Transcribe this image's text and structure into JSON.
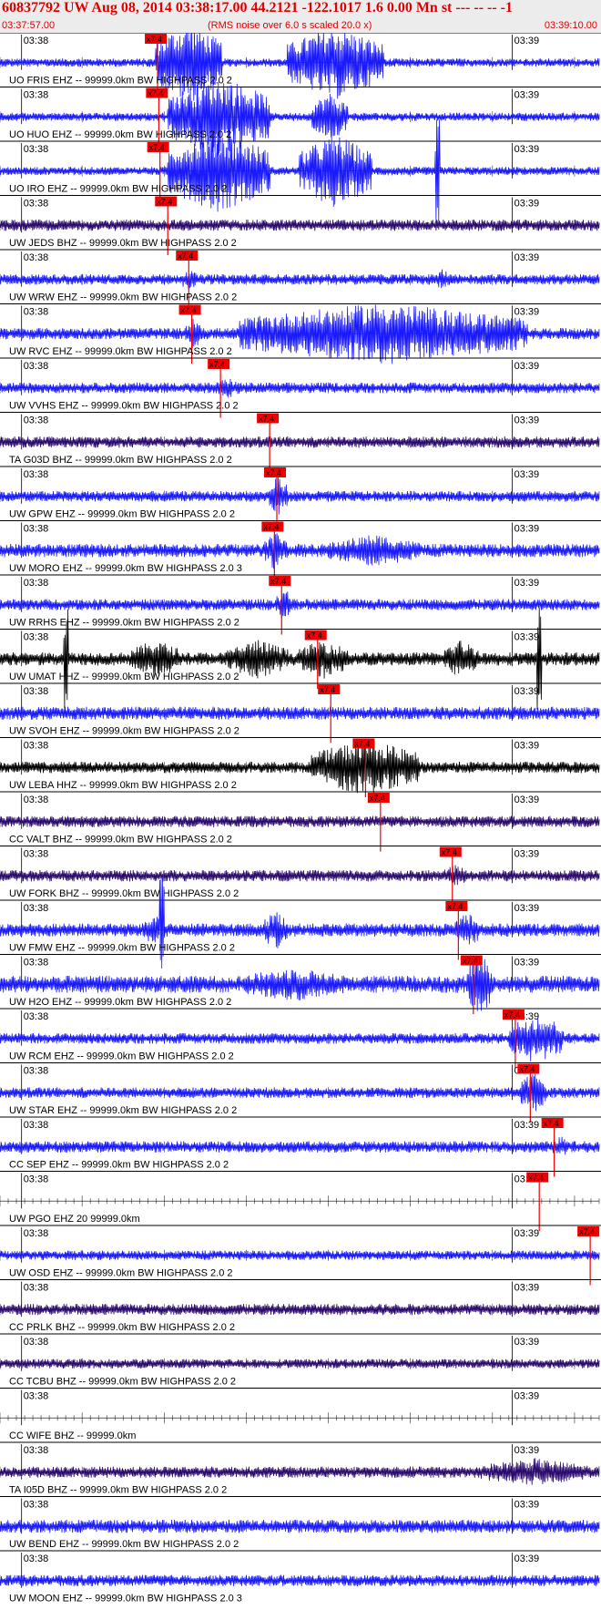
{
  "header": {
    "title": "60837792 UW Aug 08, 2014 03:38:17.00   44.2121 -122.1017  1.6 0.00 Mn st --- -- --  -1",
    "start_time": "03:37:57.00",
    "rms_note": "(RMS noise over 6.0 s scaled 20.0 x)",
    "end_time": "03:39:10.00"
  },
  "colors": {
    "blue": "#1a1aff",
    "black": "#000000",
    "navy": "#2a0a6e",
    "pick": "#ee0000",
    "header_bg": "#ececec"
  },
  "chart_data": {
    "type": "seismogram",
    "time_range": [
      "03:37:57.00",
      "03:39:10.00"
    ],
    "minute_labels": [
      "03:38",
      "03:39"
    ],
    "pick_label": "x7.4",
    "traces": [
      {
        "label": "UO FRIS EHZ -- 99999.0km BW  HIGHPASS  2.0  2",
        "color": "blue",
        "amp": 0.22,
        "pick_frac": 0.263,
        "bursts": [
          [
            0.26,
            0.37,
            10
          ],
          [
            0.48,
            0.64,
            9
          ]
        ],
        "spikes": []
      },
      {
        "label": "UO HUO EHZ -- 99999.0km BW  HIGHPASS  2.0  2",
        "color": "blue",
        "amp": 0.22,
        "pick_frac": 0.265,
        "bursts": [
          [
            0.28,
            0.45,
            10
          ],
          [
            0.52,
            0.58,
            6
          ]
        ],
        "spikes": []
      },
      {
        "label": "UO IRO EHZ -- 99999.0km BW  HIGHPASS  2.0  2",
        "color": "blue",
        "amp": 0.22,
        "pick_frac": 0.267,
        "bursts": [
          [
            0.28,
            0.45,
            10
          ],
          [
            0.5,
            0.62,
            9
          ]
        ],
        "spikes": [
          [
            0.73,
            5
          ]
        ]
      },
      {
        "label": "UW JEDS BHZ -- 99999.0km BW  HIGHPASS  2.0  2",
        "color": "navy",
        "amp": 0.3,
        "pick_frac": 0.28,
        "bursts": [],
        "spikes": []
      },
      {
        "label": "UW WRW EHZ -- 99999.0km BW  HIGHPASS  2.0  2",
        "color": "blue",
        "amp": 0.28,
        "pick_frac": 0.315,
        "bursts": [
          [
            0.3,
            0.33,
            2
          ],
          [
            0.72,
            0.76,
            2
          ]
        ],
        "spikes": []
      },
      {
        "label": "UW RVC EHZ -- 99999.0km BW  HIGHPASS  2.0  2",
        "color": "blue",
        "amp": 0.3,
        "pick_frac": 0.32,
        "bursts": [
          [
            0.31,
            0.34,
            3
          ],
          [
            0.4,
            0.88,
            5.5
          ]
        ],
        "spikes": []
      },
      {
        "label": "UW VVHS EHZ -- 99999.0km BW  HIGHPASS  2.0  2",
        "color": "blue",
        "amp": 0.28,
        "pick_frac": 0.368,
        "bursts": [
          [
            0.36,
            0.4,
            2
          ]
        ],
        "spikes": []
      },
      {
        "label": "TA G03D BHZ -- 99999.0km BW  HIGHPASS  2.0  2",
        "color": "navy",
        "amp": 0.3,
        "pick_frac": 0.45,
        "bursts": [],
        "spikes": []
      },
      {
        "label": "UW GPW EHZ -- 99999.0km BW  HIGHPASS  2.0  2",
        "color": "blue",
        "amp": 0.28,
        "pick_frac": 0.462,
        "bursts": [
          [
            0.45,
            0.48,
            4
          ]
        ],
        "spikes": []
      },
      {
        "label": "UW MORO EHZ -- 99999.0km BW  HIGHPASS  2.0  3",
        "color": "blue",
        "amp": 0.35,
        "pick_frac": 0.458,
        "bursts": [
          [
            0.44,
            0.48,
            3
          ],
          [
            0.55,
            0.7,
            2.5
          ]
        ],
        "spikes": []
      },
      {
        "label": "UW RRHS EHZ -- 99999.0km BW  HIGHPASS  2.0  2",
        "color": "blue",
        "amp": 0.3,
        "pick_frac": 0.47,
        "bursts": [
          [
            0.46,
            0.49,
            3
          ]
        ],
        "spikes": []
      },
      {
        "label": "UW UMAT HHZ -- 99999.0km BW  HIGHPASS  2.0  2",
        "color": "black",
        "amp": 0.35,
        "pick_frac": 0.53,
        "bursts": [
          [
            0.22,
            0.3,
            3
          ],
          [
            0.38,
            0.48,
            3
          ],
          [
            0.5,
            0.58,
            3
          ],
          [
            0.74,
            0.8,
            3
          ]
        ],
        "spikes": [
          [
            0.11,
            3
          ],
          [
            0.9,
            3
          ]
        ]
      },
      {
        "label": "UW SVOH EHZ -- 99999.0km BW  HIGHPASS  2.0  2",
        "color": "blue",
        "amp": 0.35,
        "pick_frac": 0.552,
        "bursts": [],
        "spikes": []
      },
      {
        "label": "UW LEBA HHZ -- 99999.0km BW  HIGHPASS  2.0  2",
        "color": "black",
        "amp": 0.3,
        "pick_frac": 0.61,
        "bursts": [
          [
            0.52,
            0.7,
            5
          ]
        ],
        "spikes": []
      },
      {
        "label": "CC VALT BHZ -- 99999.0km BW  HIGHPASS  2.0  2",
        "color": "navy",
        "amp": 0.3,
        "pick_frac": 0.635,
        "bursts": [],
        "spikes": []
      },
      {
        "label": "UW FORK BHZ -- 99999.0km BW  HIGHPASS  2.0  2",
        "color": "navy",
        "amp": 0.3,
        "pick_frac": 0.755,
        "bursts": [
          [
            0.74,
            0.78,
            2
          ]
        ],
        "spikes": []
      },
      {
        "label": "UW FMW EHZ -- 99999.0km BW  HIGHPASS  2.0  2",
        "color": "blue",
        "amp": 0.35,
        "pick_frac": 0.765,
        "bursts": [
          [
            0.24,
            0.28,
            2.5
          ],
          [
            0.44,
            0.48,
            3
          ],
          [
            0.76,
            0.8,
            3
          ]
        ],
        "spikes": [
          [
            0.27,
            4
          ]
        ]
      },
      {
        "label": "UW H2O EHZ -- 99999.0km BW  HIGHPASS  2.0  2",
        "color": "blue",
        "amp": 0.45,
        "pick_frac": 0.79,
        "bursts": [
          [
            0.4,
            0.58,
            2
          ],
          [
            0.78,
            0.82,
            4
          ]
        ],
        "spikes": []
      },
      {
        "label": "UW RCM EHZ -- 99999.0km BW  HIGHPASS  2.0  2",
        "color": "blue",
        "amp": 0.28,
        "pick_frac": 0.86,
        "bursts": [
          [
            0.85,
            0.94,
            5
          ]
        ],
        "spikes": []
      },
      {
        "label": "UW STAR EHZ -- 99999.0km BW  HIGHPASS  2.0  2",
        "color": "blue",
        "amp": 0.28,
        "pick_frac": 0.885,
        "bursts": [
          [
            0.87,
            0.91,
            4
          ]
        ],
        "spikes": []
      },
      {
        "label": "CC SEP EHZ -- 99999.0km BW  HIGHPASS  2.0  2",
        "color": "blue",
        "amp": 0.3,
        "pick_frac": 0.925,
        "bursts": [
          [
            0.92,
            0.95,
            2
          ]
        ],
        "spikes": []
      },
      {
        "label": "UW PGO EHZ 20 99999.0km",
        "color": "none",
        "amp": 0,
        "pick_frac": 0.9,
        "bursts": [],
        "spikes": []
      },
      {
        "label": "UW OSD EHZ -- 99999.0km BW  HIGHPASS  2.0  2",
        "color": "blue",
        "amp": 0.25,
        "pick_frac": 0.985,
        "bursts": [],
        "spikes": []
      },
      {
        "label": "CC PRLK BHZ -- 99999.0km BW  HIGHPASS  2.0  2",
        "color": "navy",
        "amp": 0.3,
        "pick_frac": -1,
        "bursts": [],
        "spikes": []
      },
      {
        "label": "CC TCBU BHZ -- 99999.0km BW  HIGHPASS  2.0  2",
        "color": "navy",
        "amp": 0.25,
        "pick_frac": -1,
        "bursts": [],
        "spikes": []
      },
      {
        "label": "CC WIFE BHZ -- 99999.0km",
        "color": "none",
        "amp": 0,
        "pick_frac": -1,
        "bursts": [],
        "spikes": []
      },
      {
        "label": "TA I05D BHZ -- 99999.0km BW  HIGHPASS  2.0  2",
        "color": "navy",
        "amp": 0.3,
        "pick_frac": -1,
        "bursts": [
          [
            0.8,
            0.98,
            2.5
          ]
        ],
        "spikes": []
      },
      {
        "label": "UW BEND EHZ -- 99999.0km BW  HIGHPASS  2.0  2",
        "color": "blue",
        "amp": 0.35,
        "pick_frac": -1,
        "bursts": [],
        "spikes": []
      },
      {
        "label": "UW MOON EHZ -- 99999.0km BW  HIGHPASS  2.0  3",
        "color": "blue",
        "amp": 0.3,
        "pick_frac": -1,
        "bursts": [],
        "spikes": []
      }
    ]
  }
}
